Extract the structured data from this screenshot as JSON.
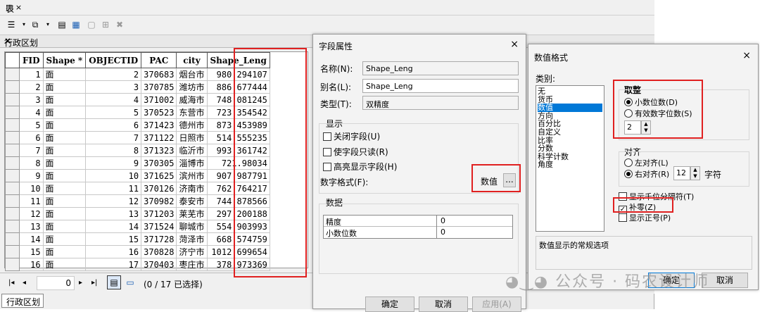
{
  "table_window": {
    "title": "表",
    "ctrl": "□ ×",
    "tab_label": "行政区划",
    "tab_close": "×",
    "columns": [
      "FID",
      "Shape *",
      "OBJECTID",
      "PAC",
      "city",
      "Shape_Leng"
    ],
    "rows": [
      [
        "1",
        "面",
        "2",
        "370683",
        "烟台市",
        "980.294107"
      ],
      [
        "2",
        "面",
        "3",
        "370785",
        "潍坊市",
        "886.677444"
      ],
      [
        "3",
        "面",
        "4",
        "371002",
        "威海市",
        "748.081245"
      ],
      [
        "4",
        "面",
        "5",
        "370523",
        "东营市",
        "723.354542"
      ],
      [
        "5",
        "面",
        "6",
        "371423",
        "德州市",
        "873.453989"
      ],
      [
        "6",
        "面",
        "7",
        "371122",
        "日照市",
        "514.555235"
      ],
      [
        "7",
        "面",
        "8",
        "371323",
        "临沂市",
        "993.361742"
      ],
      [
        "8",
        "面",
        "9",
        "370305",
        "淄博市",
        "721.98034"
      ],
      [
        "9",
        "面",
        "10",
        "371625",
        "滨州市",
        "907.987791"
      ],
      [
        "10",
        "面",
        "11",
        "370126",
        "济南市",
        "762.764217"
      ],
      [
        "11",
        "面",
        "12",
        "370982",
        "泰安市",
        "744.878566"
      ],
      [
        "12",
        "面",
        "13",
        "371203",
        "莱芜市",
        "297.200188"
      ],
      [
        "13",
        "面",
        "14",
        "371524",
        "聊城市",
        "554.903993"
      ],
      [
        "14",
        "面",
        "15",
        "371728",
        "菏泽市",
        "668.574759"
      ],
      [
        "15",
        "面",
        "16",
        "370828",
        "济宁市",
        "1012.699654"
      ],
      [
        "16",
        "面",
        "17",
        "370403",
        "枣庄市",
        "378.973369"
      ]
    ],
    "nav": {
      "first": "|◂",
      "prev": "◂",
      "current": "0",
      "next": "▸",
      "last": "▸|"
    },
    "selection_status": "(0 / 17 已选择)",
    "bottom_tab": "行政区划",
    "toolbar_icons": [
      "table-options-icon",
      "related-tables-icon",
      "select-by-attributes-icon",
      "switch-selection-icon",
      "clear-selection-icon",
      "zoom-to-selected-icon",
      "delete-selected-icon"
    ]
  },
  "field_dialog": {
    "title": "字段属性",
    "close": "×",
    "name_label": "名称(N):",
    "name_value": "Shape_Leng",
    "alias_label": "别名(L):",
    "alias_value": "Shape_Leng",
    "type_label": "类型(T):",
    "type_value": "双精度",
    "display_group": "显示",
    "cb_close_field": "关闭字段(U)",
    "cb_readonly": "使字段只读(R)",
    "cb_highlight": "高亮显示字段(H)",
    "number_format_label": "数字格式(F):",
    "number_format_value": "数值",
    "ellipsis": "...",
    "data_group": "数据",
    "data_rows": [
      [
        "精度",
        "0"
      ],
      [
        "小数位数",
        "0"
      ]
    ],
    "ok": "确定",
    "cancel": "取消",
    "apply": "应用(A)"
  },
  "numfmt_dialog": {
    "title": "数值格式",
    "close": "×",
    "category_label": "类别:",
    "categories": [
      "无",
      "货币",
      "数值",
      "方向",
      "百分比",
      "自定义",
      "比率",
      "分数",
      "科学计数",
      "角度"
    ],
    "selected_category": "数值",
    "rounding_group": "取整",
    "radio_decimal": "小数位数(D)",
    "radio_significant": "有效数字位数(S)",
    "decimal_value": "2",
    "align_group": "对齐",
    "radio_left": "左对齐(L)",
    "radio_right": "右对齐(R)",
    "align_width": "12",
    "chars_label": "字符",
    "cb_thousands": "显示千位分隔符(T)",
    "cb_pad_zeros": "补零(Z)",
    "cb_show_plus": "显示正号(P)",
    "description": "数值显示的常规选项",
    "ok": "确定",
    "cancel": "取消"
  },
  "watermark": "公众号 · 码农设计师",
  "colors": {
    "highlight_red": "#e02020",
    "selection_blue": "#0078d7"
  }
}
